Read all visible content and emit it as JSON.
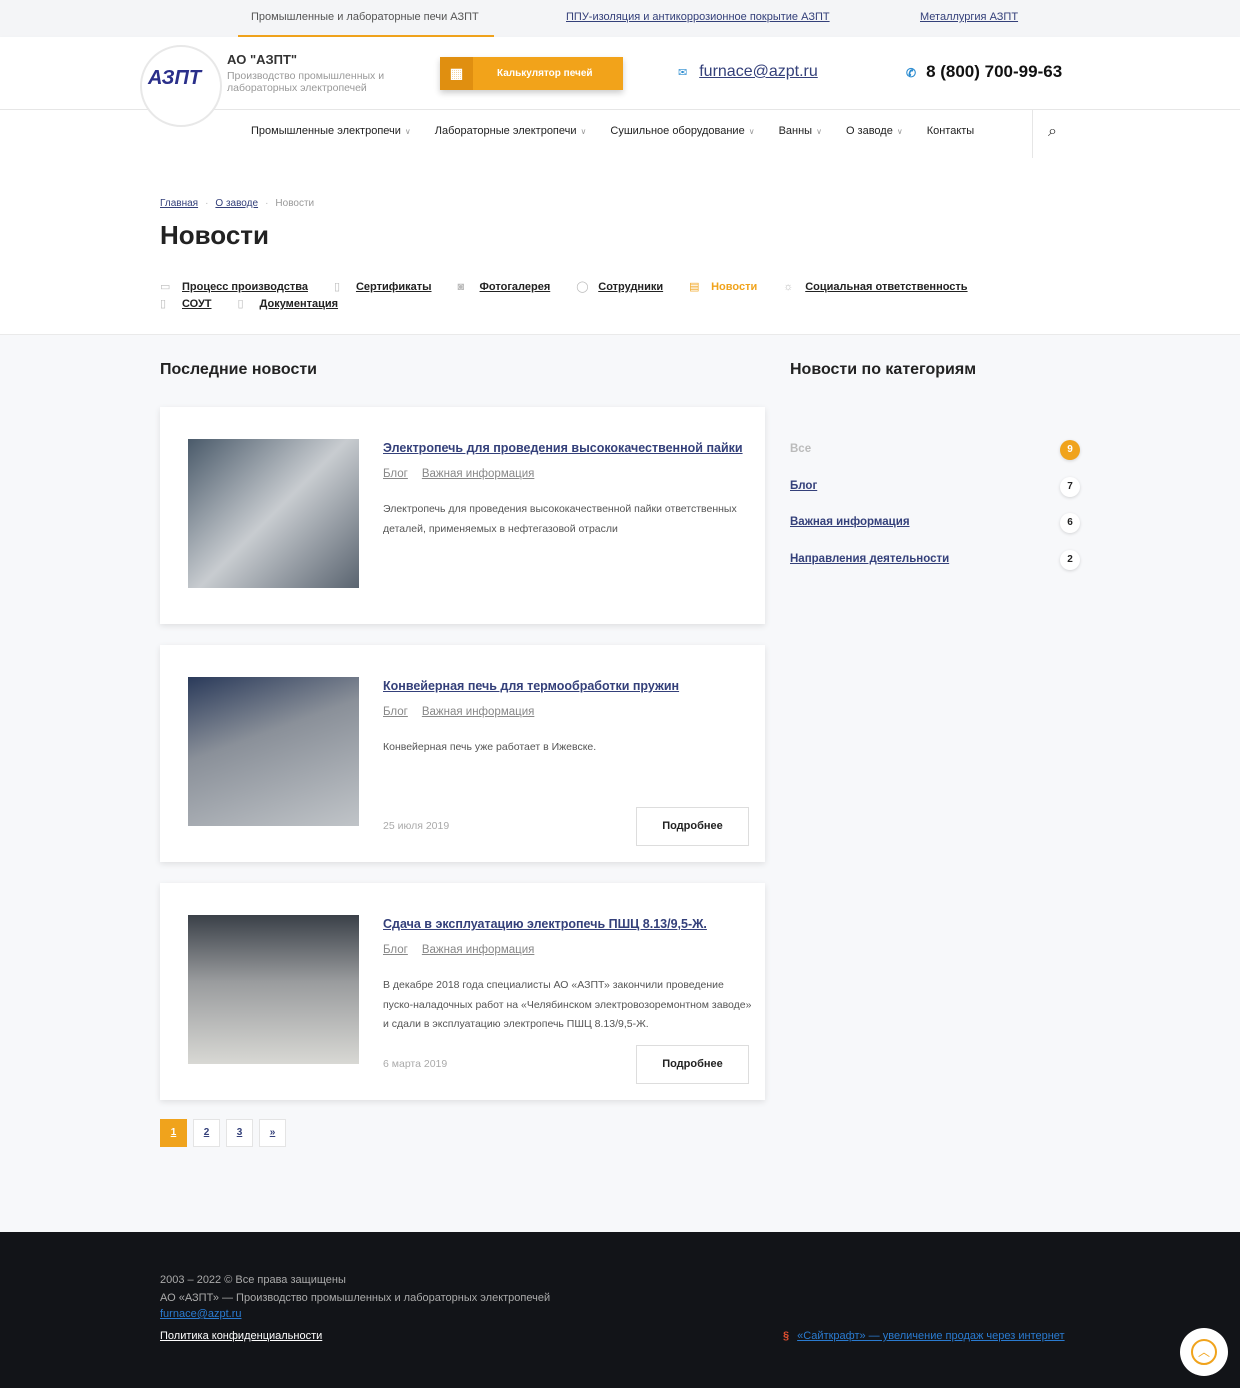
{
  "topbar": {
    "sites": [
      "Промышленные и лабораторные печи АЗПТ",
      "ППУ-изоляция и антикоррозионное покрытие АЗПТ",
      "Металлургия АЗПТ"
    ]
  },
  "header": {
    "logo_text": "АЗПТ",
    "company": "АО \"АЗПТ\"",
    "desc": "Производство промышленных и лабораторных электропечей",
    "calc": "Калькулятор печей",
    "email": "furnace@azpt.ru",
    "phone": "8 (800) 700-99-63"
  },
  "nav": [
    "Промышленные электропечи",
    "Лабораторные электропечи",
    "Сушильное оборудование",
    "Ванны",
    "О заводе",
    "Контакты"
  ],
  "breadcrumbs": [
    "Главная",
    "О заводе",
    "Новости"
  ],
  "title": "Новости",
  "subnav": [
    "Процесс производства",
    "Сертификаты",
    "Фотогалерея",
    "Сотрудники",
    "Новости",
    "Социальная ответственность",
    "СОУТ",
    "Документация"
  ],
  "latest_title": "Последние новости",
  "news": [
    {
      "title": "Электропечь для проведения высококачественной пайки",
      "tags": [
        "Блог",
        "Важная информация"
      ],
      "text": "Электропечь для проведения высококачественной пайки ответственных деталей, применяемых в нефтегазовой отрасли"
    },
    {
      "title": "Конвейерная печь для термообработки пружин",
      "tags": [
        "Блог",
        "Важная информация"
      ],
      "text": "Конвейерная печь уже работает в Ижевске.",
      "date": "25 июля 2019",
      "more": "Подробнее"
    },
    {
      "title": "Сдача в эксплуатацию электропечь ПШЦ 8.13/9,5-Ж.",
      "tags": [
        "Блог",
        "Важная информация"
      ],
      "text": "В декабре 2018 года специалисты АО «АЗПТ» закончили проведение пуско-наладочных работ на «Челябинском электровозоремонтном заводе» и сдали в эксплуатацию электропечь ПШЦ 8.13/9,5-Ж.",
      "date": "6 марта 2019",
      "more": "Подробнее"
    }
  ],
  "pager": [
    "1",
    "2",
    "3",
    "»"
  ],
  "categories_title": "Новости по категориям",
  "categories": [
    {
      "label": "Все",
      "count": "9"
    },
    {
      "label": "Блог",
      "count": "7"
    },
    {
      "label": "Важная информация",
      "count": "6"
    },
    {
      "label": "Направления деятельности",
      "count": "2"
    }
  ],
  "footer": {
    "copy": "2003 – 2022 © Все права защищены",
    "company": "АО «АЗПТ» — Производство промышленных и лабораторных электропечей",
    "email": "furnace@azpt.ru",
    "policy": "Политика конфиденциальности",
    "dev": "«Сайткрафт» — увеличение продаж через интернет"
  },
  "colors": {
    "accent": "#f0a31c",
    "link": "#34407a",
    "footer": "#121418"
  }
}
